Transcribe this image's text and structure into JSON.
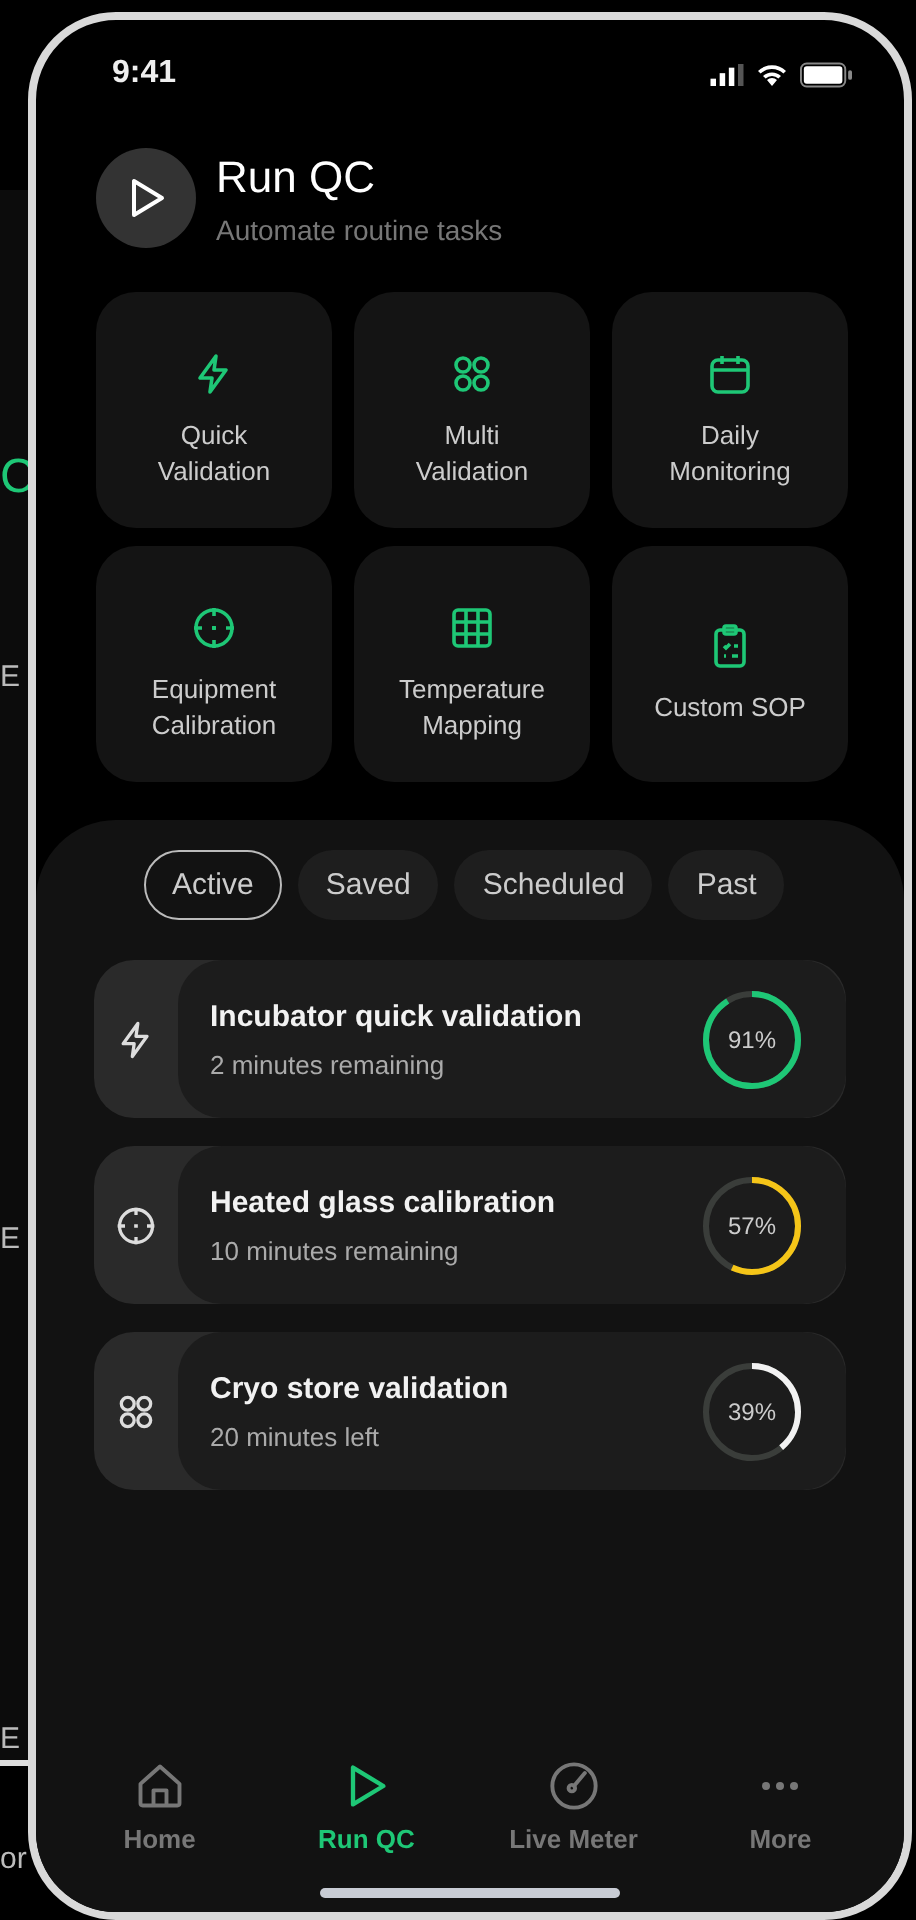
{
  "background_screen": {
    "fragments": [
      {
        "text": "C",
        "kind": "accent"
      },
      {
        "text": "E",
        "kind": "plain"
      },
      {
        "text": "E",
        "kind": "plain"
      },
      {
        "text": "E",
        "kind": "plain"
      },
      {
        "text": "or",
        "kind": "plain"
      }
    ]
  },
  "status_bar": {
    "time": "9:41"
  },
  "header": {
    "title": "Run QC",
    "subtitle": "Automate routine tasks"
  },
  "actions": [
    {
      "label": "Quick Validation"
    },
    {
      "label": "Multi Validation"
    },
    {
      "label": "Daily Monitoring"
    },
    {
      "label": "Equipment Calibration"
    },
    {
      "label": "Temperature Mapping"
    },
    {
      "label": "Custom SOP"
    }
  ],
  "tabs": [
    {
      "label": "Active",
      "selected": true
    },
    {
      "label": "Saved",
      "selected": false
    },
    {
      "label": "Scheduled",
      "selected": false
    },
    {
      "label": "Past",
      "selected": false
    }
  ],
  "runs": [
    {
      "title": "Incubator quick validation",
      "subtitle": "2 minutes remaining",
      "level": 0.91,
      "reading": "91%",
      "color": "#1ec776"
    },
    {
      "title": "Heated glass calibration",
      "subtitle": "10 minutes remaining",
      "level": 0.57,
      "reading": "57%",
      "color": "#f5c518"
    },
    {
      "title": "Cryo store validation",
      "subtitle": "20 minutes left",
      "level": 0.39,
      "reading": "39%",
      "color": "#f2f2f2"
    }
  ],
  "nav": [
    {
      "label": "Home",
      "selected": false
    },
    {
      "label": "Run QC",
      "selected": true
    },
    {
      "label": "Live Meter",
      "selected": false
    },
    {
      "label": "More",
      "selected": false
    }
  ]
}
